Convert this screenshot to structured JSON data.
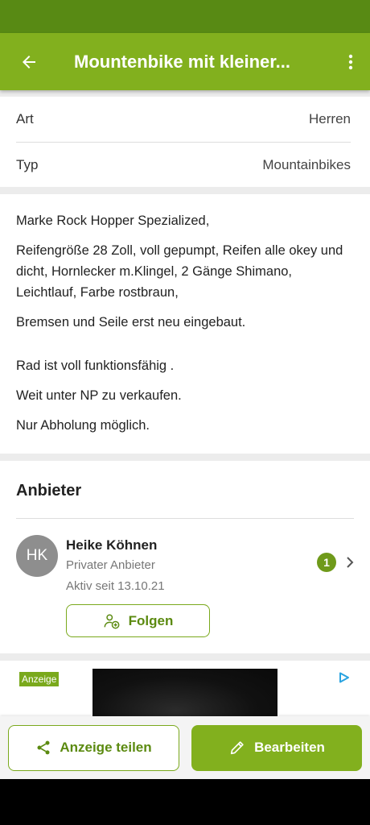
{
  "app_bar": {
    "title": "Mountenbike  mit kleiner...",
    "back_icon": "arrow-left-icon",
    "menu_icon": "more-vertical-icon"
  },
  "attributes": [
    {
      "label": "Art",
      "value": "Herren"
    },
    {
      "label": "Typ",
      "value": "Mountainbikes"
    }
  ],
  "description": {
    "p1": "Marke Rock Hopper Spezialized,",
    "p2": "Reifengröße 28 Zoll, voll gepumpt, Reifen alle okey und dicht, Hornlecker m.Klingel, 2 Gänge Shimano, Leichtlauf, Farbe rostbraun,",
    "p3": "Bremsen und Seile erst neu eingebaut.",
    "p4": "Rad ist voll funktionsfähig .",
    "p5": "Weit unter NP zu verkaufen.",
    "p6": "Nur Abholung möglich."
  },
  "seller": {
    "heading": "Anbieter",
    "initials": "HK",
    "name": "Heike Köhnen",
    "type": "Privater Anbieter",
    "active": "Aktiv seit 13.10.21",
    "listing_count": "1",
    "follow_label": "Folgen"
  },
  "ad": {
    "label": "Anzeige"
  },
  "bottom_bar": {
    "share_label": "Anzeige teilen",
    "edit_label": "Bearbeiten"
  },
  "colors": {
    "status_bar": "#588a14",
    "primary": "#82b01e",
    "primary_dark": "#5b8a10"
  }
}
